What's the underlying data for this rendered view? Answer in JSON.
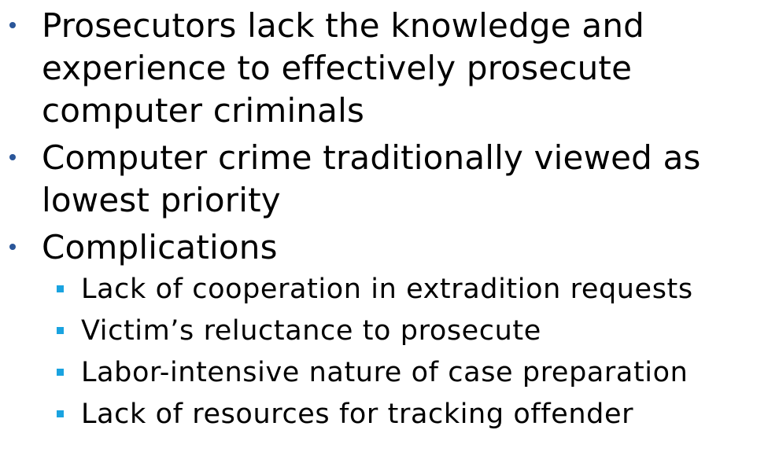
{
  "colors": {
    "level1_bullet": "#2a5699",
    "level2_bullet": "#1aa3e0",
    "text": "#000000"
  },
  "bullets": [
    {
      "text": "Prosecutors lack the knowledge and experience to effectively prosecute computer criminals",
      "lines": [
        "Prosecutors lack the knowledge and",
        "experience to effectively prosecute",
        "computer criminals"
      ]
    },
    {
      "text": "Computer crime traditionally viewed as lowest priority",
      "lines": [
        "Computer crime traditionally viewed as",
        "lowest priority"
      ]
    },
    {
      "text": "Complications",
      "lines": [
        "Complications"
      ],
      "sub": [
        "Lack of cooperation in extradition requests",
        "Victim’s reluctance to prosecute",
        "Labor-intensive nature of case preparation",
        "Lack of resources for tracking offender"
      ]
    }
  ]
}
